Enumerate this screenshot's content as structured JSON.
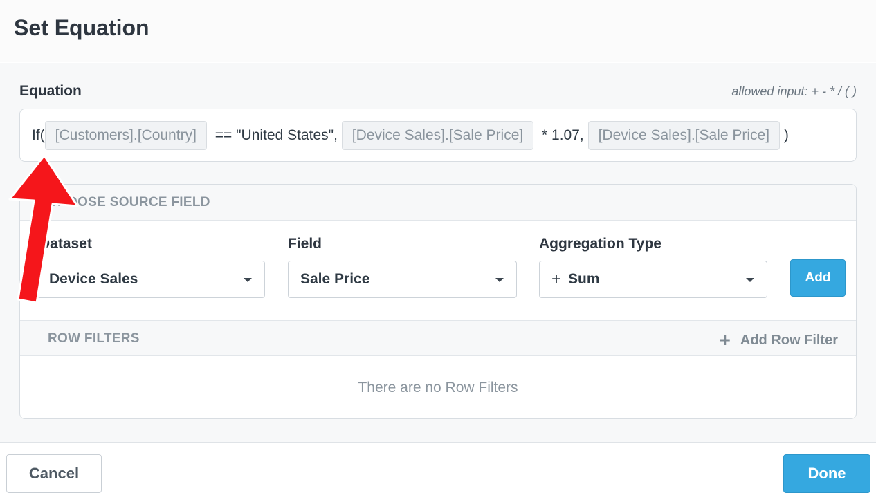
{
  "dialog": {
    "title": "Set Equation"
  },
  "equation": {
    "label": "Equation",
    "hint": "allowed input: + - * / ( )",
    "parts": {
      "p1": "If(",
      "t1": "[Customers].[Country]",
      "p2": " == \"United States\", ",
      "t2": "[Device Sales].[Sale Price]",
      "p3": " * 1.07, ",
      "t3": "[Device Sales].[Sale Price]",
      "p4": " )"
    }
  },
  "source_field": {
    "title": "CHOOSE SOURCE FIELD",
    "dataset": {
      "label": "Dataset",
      "value": "Device Sales"
    },
    "field": {
      "label": "Field",
      "value": "Sale Price"
    },
    "aggregation": {
      "label": "Aggregation Type",
      "icon": "+",
      "value": "Sum"
    },
    "add_label": "Add"
  },
  "row_filters": {
    "title": "ROW FILTERS",
    "add_label": "Add Row Filter",
    "add_icon": "+",
    "empty_message": "There are no Row Filters"
  },
  "footer": {
    "cancel_label": "Cancel",
    "done_label": "Done"
  },
  "colors": {
    "accent": "#35a8e0",
    "annotation_arrow": "#f5161b"
  }
}
